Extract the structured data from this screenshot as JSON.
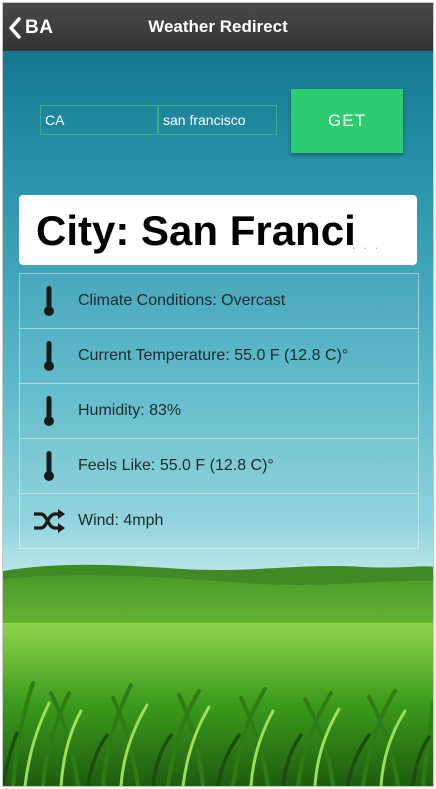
{
  "header": {
    "back_label": "BA",
    "title": "Weather Redirect"
  },
  "form": {
    "state_value": "CA",
    "city_value": "san francisco",
    "get_label": "GET"
  },
  "city": {
    "title": "City: San Franci",
    "ellipsis": ". . ."
  },
  "conditions": [
    {
      "icon": "thermometer-icon",
      "label": "Climate Conditions: Overcast"
    },
    {
      "icon": "thermometer-icon",
      "label": "Current Temperature: 55.0 F (12.8 C)°"
    },
    {
      "icon": "thermometer-icon",
      "label": "Humidity: 83%"
    },
    {
      "icon": "thermometer-icon",
      "label": "Feels Like: 55.0 F (12.8 C)°"
    },
    {
      "icon": "shuffle-icon",
      "label": "Wind: 4mph"
    }
  ],
  "colors": {
    "header": "#3b3b3b",
    "accent": "#2ecc71",
    "sky_top": "#0c6e86",
    "grass": "#4caf1e"
  }
}
